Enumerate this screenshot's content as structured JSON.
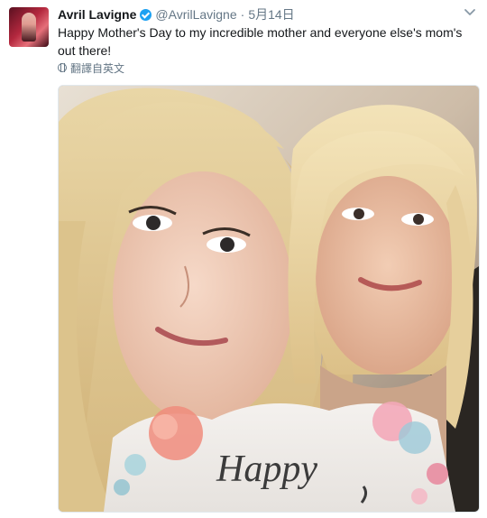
{
  "tweet": {
    "author_name": "Avril Lavigne",
    "handle": "@AvrilLavigne",
    "separator": "·",
    "timestamp": "5月14日",
    "text": "Happy Mother's Day to my incredible mother and everyone else's mom's out there!",
    "translate_label": "翻譯自英文",
    "photo_caption_text": "Happy"
  },
  "icons": {
    "verified": "verified-badge-icon",
    "caret": "chevron-down-icon",
    "translate": "globe-icon"
  },
  "colors": {
    "accent": "#1da1f2",
    "secondary_text": "#657786",
    "primary_text": "#14171a"
  }
}
